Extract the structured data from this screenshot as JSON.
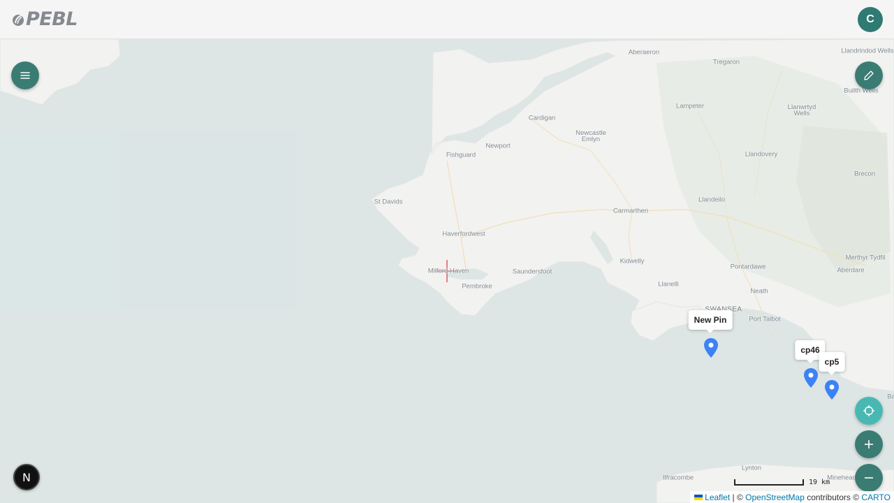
{
  "app": {
    "logo_text": "PEBL",
    "avatar_initial": "C"
  },
  "map": {
    "places": [
      {
        "name": "Aberaeron",
        "type": "town"
      },
      {
        "name": "Tregaron",
        "type": "town"
      },
      {
        "name": "Llandrindod Wells",
        "type": "town"
      },
      {
        "name": "Builth Wells",
        "type": "town"
      },
      {
        "name": "Lampeter",
        "type": "town"
      },
      {
        "name": "Llanwrtyd Wells",
        "type": "town"
      },
      {
        "name": "Cardigan",
        "type": "town"
      },
      {
        "name": "Newcastle Emlyn",
        "type": "town"
      },
      {
        "name": "Fishguard",
        "type": "town"
      },
      {
        "name": "Newport",
        "type": "town"
      },
      {
        "name": "Llandovery",
        "type": "town"
      },
      {
        "name": "Brecon",
        "type": "town"
      },
      {
        "name": "St Davids",
        "type": "town"
      },
      {
        "name": "Carmarthen",
        "type": "town"
      },
      {
        "name": "Llandeilo",
        "type": "town"
      },
      {
        "name": "Haverfordwest",
        "type": "town"
      },
      {
        "name": "Kidwelly",
        "type": "town"
      },
      {
        "name": "Pontardawe",
        "type": "town"
      },
      {
        "name": "Merthyr Tydfil",
        "type": "town"
      },
      {
        "name": "Aberdare",
        "type": "town"
      },
      {
        "name": "Milford Haven",
        "type": "town"
      },
      {
        "name": "Saundersfoot",
        "type": "town"
      },
      {
        "name": "Pembroke",
        "type": "town"
      },
      {
        "name": "Llanelli",
        "type": "town"
      },
      {
        "name": "Neath",
        "type": "town"
      },
      {
        "name": "SWANSEA",
        "type": "city"
      },
      {
        "name": "Port Talbot",
        "type": "town"
      },
      {
        "name": "Lynton",
        "type": "town"
      },
      {
        "name": "Ilfracombe",
        "type": "town"
      },
      {
        "name": "Minehead",
        "type": "town"
      },
      {
        "name": "Ba",
        "type": "town"
      }
    ],
    "pins": [
      {
        "label": "New Pin",
        "color": "#3b82f6"
      },
      {
        "label": "cp46",
        "color": "#3b82f6"
      },
      {
        "label": "cp5",
        "color": "#3b82f6"
      }
    ],
    "scale_label": "19 km",
    "attribution": {
      "leaflet": "Leaflet",
      "separator": " | © ",
      "osm": "OpenStreetMap",
      "contributors": " contributors © ",
      "carto": "CARTO"
    }
  },
  "controls": {
    "menu_icon": "menu-icon",
    "edit_icon": "pencil-icon",
    "locate_icon": "crosshair-icon",
    "zoom_in_icon": "plus-icon",
    "zoom_out_icon": "minus-icon",
    "dev_badge": "N"
  },
  "colors": {
    "accent": "#3a7c73",
    "accent_light": "#49b8b3",
    "sea": "#dde5e5",
    "land": "#f2f2f0",
    "pin": "#3b82f6"
  }
}
